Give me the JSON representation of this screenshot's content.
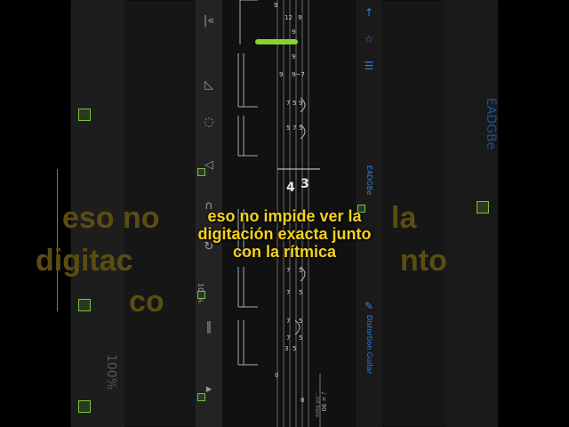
{
  "caption": {
    "line1": "eso no impide ver la",
    "line2": "digitación exacta junto",
    "line3": "con la rítmica"
  },
  "background_caption": {
    "line1": "eso no",
    "line1b": "la",
    "line2": "digitac",
    "line2b": "nto",
    "line3": "co"
  },
  "right_panel": {
    "tuning": "EADGBe",
    "instrument": "Distortion Guitar",
    "tuning_bg": "EADGBe"
  },
  "toolbar": {
    "speed": "100%",
    "speed_bg": "100%"
  },
  "score": {
    "time_sig_top": "3",
    "time_sig_bottom": "4",
    "tempo": "♩ = 90",
    "tempo_note": "...int here",
    "frets": [
      "9",
      "12",
      "9",
      "9",
      "9",
      "9~7",
      "9",
      "7",
      "5",
      "9",
      "5",
      "7",
      "5",
      "7",
      "5",
      "7",
      "5",
      "7",
      "5",
      "7",
      "5",
      "5",
      "3",
      "0",
      "8"
    ]
  },
  "colors": {
    "caption": "#f6d21e",
    "accent": "#2f7fe8",
    "green": "#7bc043"
  }
}
